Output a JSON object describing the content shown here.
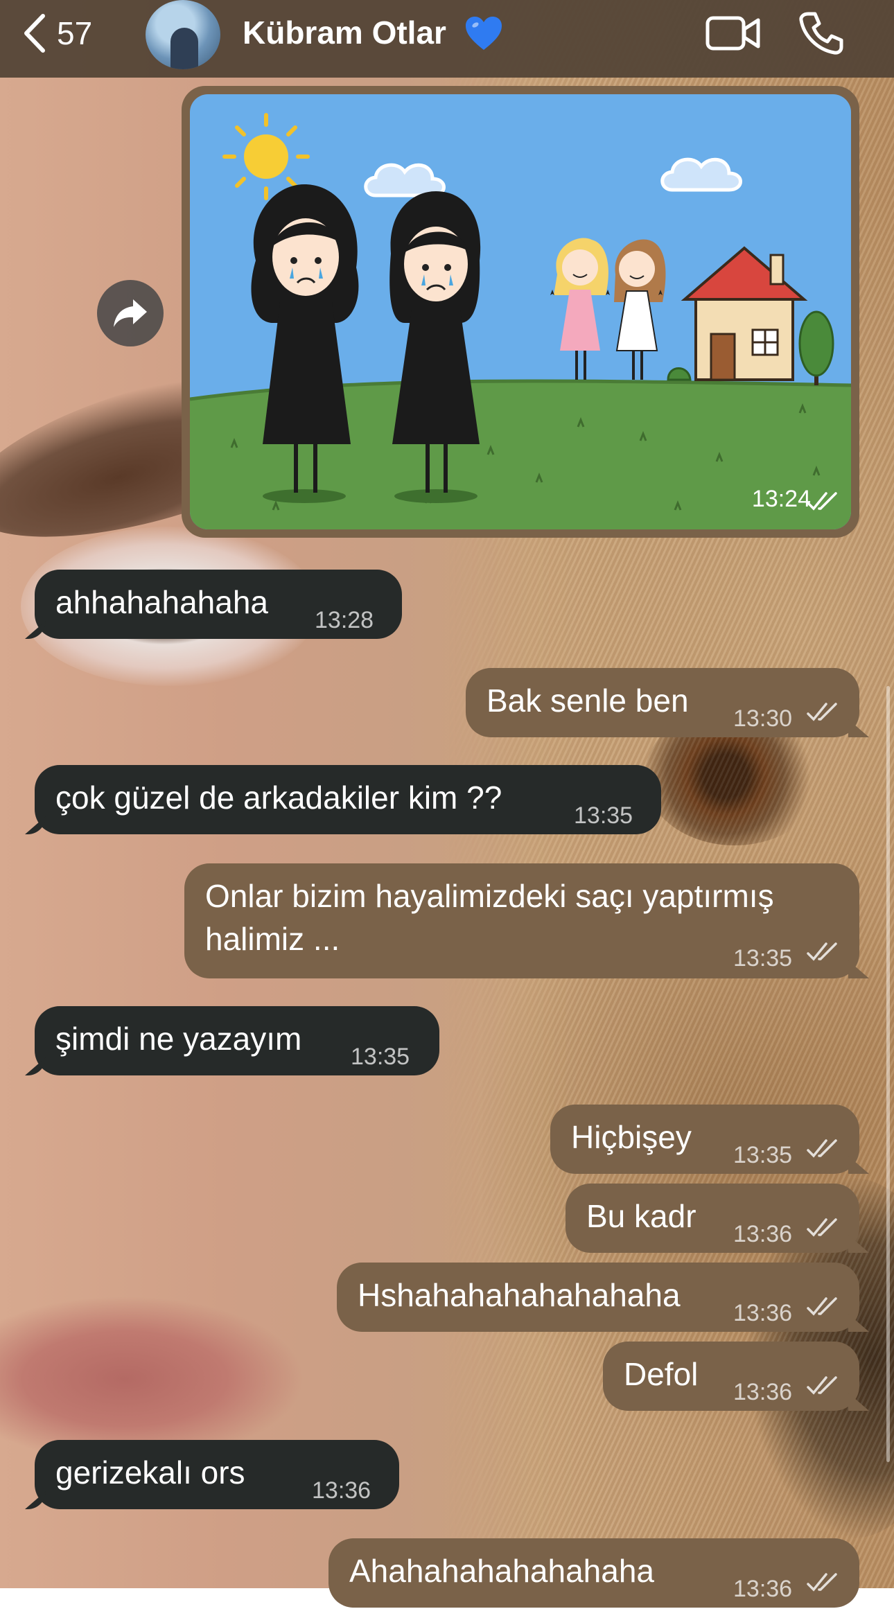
{
  "header": {
    "back_count": "57",
    "contact_name": "Kübram Otlar",
    "name_emoji": "heart-emoji-blue"
  },
  "icons": {
    "back": "chevron-left-icon",
    "video": "video-camera-icon",
    "phone": "phone-icon",
    "forward": "forward-arrow-icon",
    "read": "double-check-icon"
  },
  "colors": {
    "header": "#554637",
    "incoming_bubble": "#262a29",
    "outgoing_bubble": "#7a6249",
    "heart": "#2f7bf1"
  },
  "messages": [
    {
      "kind": "image",
      "direction": "out",
      "time": "13:24",
      "read": true,
      "illustration": "two crying girls in black dresses, two smiling girls, a house under a sunny sky"
    },
    {
      "direction": "in",
      "text": "ahhahahahaha",
      "time": "13:28"
    },
    {
      "direction": "out",
      "text": "Bak senle ben",
      "time": "13:30",
      "read": true
    },
    {
      "direction": "in",
      "text": "çok güzel de arkadakiler kim ??",
      "time": "13:35"
    },
    {
      "direction": "out",
      "lines": [
        "Onlar bizim hayalimizdeki saçı yaptırmış",
        "halimiz ..."
      ],
      "time": "13:35",
      "read": true
    },
    {
      "direction": "in",
      "text": "şimdi ne yazayım",
      "time": "13:35"
    },
    {
      "direction": "out",
      "text": "Hiçbişey",
      "time": "13:35",
      "read": true
    },
    {
      "direction": "out",
      "text": "Bu kadr",
      "time": "13:36",
      "read": true
    },
    {
      "direction": "out",
      "text": "Hshahahahahahahaha",
      "time": "13:36",
      "read": true
    },
    {
      "direction": "out",
      "text": "Defol",
      "time": "13:36",
      "read": true
    },
    {
      "direction": "in",
      "text": "gerizekalı ors",
      "time": "13:36"
    },
    {
      "direction": "out",
      "text": "Ahahahahahahahaha",
      "time": "13:36",
      "read": true
    }
  ]
}
